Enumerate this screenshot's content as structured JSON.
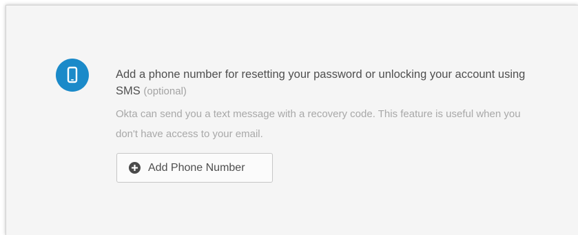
{
  "phone_section": {
    "icon": "phone-icon",
    "title": "Add a phone number for resetting your password or unlocking your account using SMS",
    "optional_label": "(optional)",
    "description": "Okta can send you a text message with a recovery code. This feature is useful when you don't have access to your email.",
    "add_button": {
      "icon": "plus-circle-icon",
      "label": "Add Phone Number"
    }
  },
  "colors": {
    "accent": "#1b8ac9",
    "panel_background": "#f5f5f5",
    "title_text": "#4f4f4f",
    "muted_text": "#a8a8a8"
  }
}
